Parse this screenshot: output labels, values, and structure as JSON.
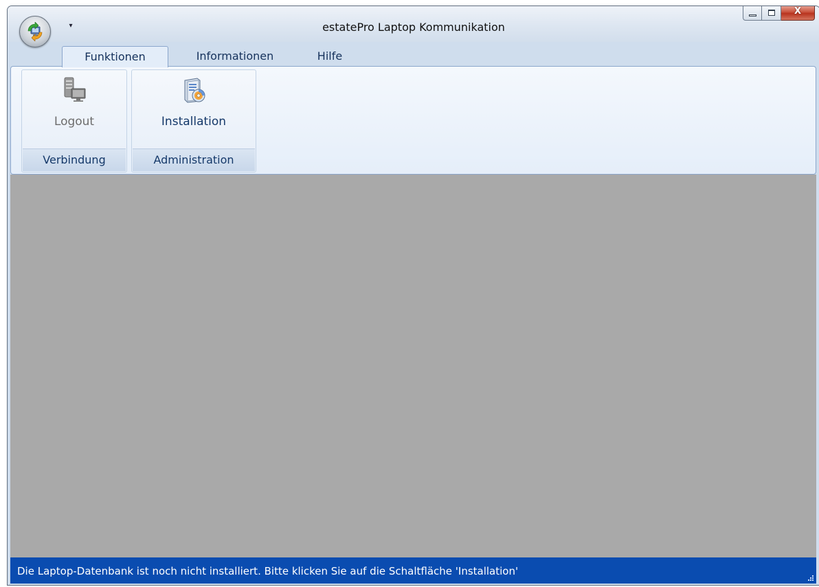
{
  "window": {
    "title": "estatePro Laptop Kommunikation",
    "caption_buttons": {
      "close_label": "X"
    }
  },
  "app_menu": {
    "icon": "app-orb-sync-icon",
    "quick_access_icon": "quick-access-dropdown-icon",
    "quick_access_glyph": "▾"
  },
  "ribbon": {
    "tabs": [
      {
        "label": "Funktionen",
        "active": true
      },
      {
        "label": "Informationen",
        "active": false
      },
      {
        "label": "Hilfe",
        "active": false
      }
    ],
    "groups": [
      {
        "label": "Verbindung",
        "buttons": [
          {
            "label": "Logout",
            "icon": "server-computer-icon",
            "enabled": false
          }
        ]
      },
      {
        "label": "Administration",
        "buttons": [
          {
            "label": "Installation",
            "icon": "installer-cd-icon",
            "enabled": true
          }
        ]
      }
    ]
  },
  "status_bar": {
    "message": "Die Laptop-Datenbank ist noch nicht installiert. Bitte klicken Sie auf die Schaltfläche 'Installation'"
  },
  "colors": {
    "status_bar_bg": "#0a4cb0",
    "content_bg": "#a9a9a9",
    "ribbon_bg": "#e5eef9",
    "tab_text": "#16325c",
    "disabled_text": "#6d6d6d",
    "enabled_text": "#15396a"
  }
}
